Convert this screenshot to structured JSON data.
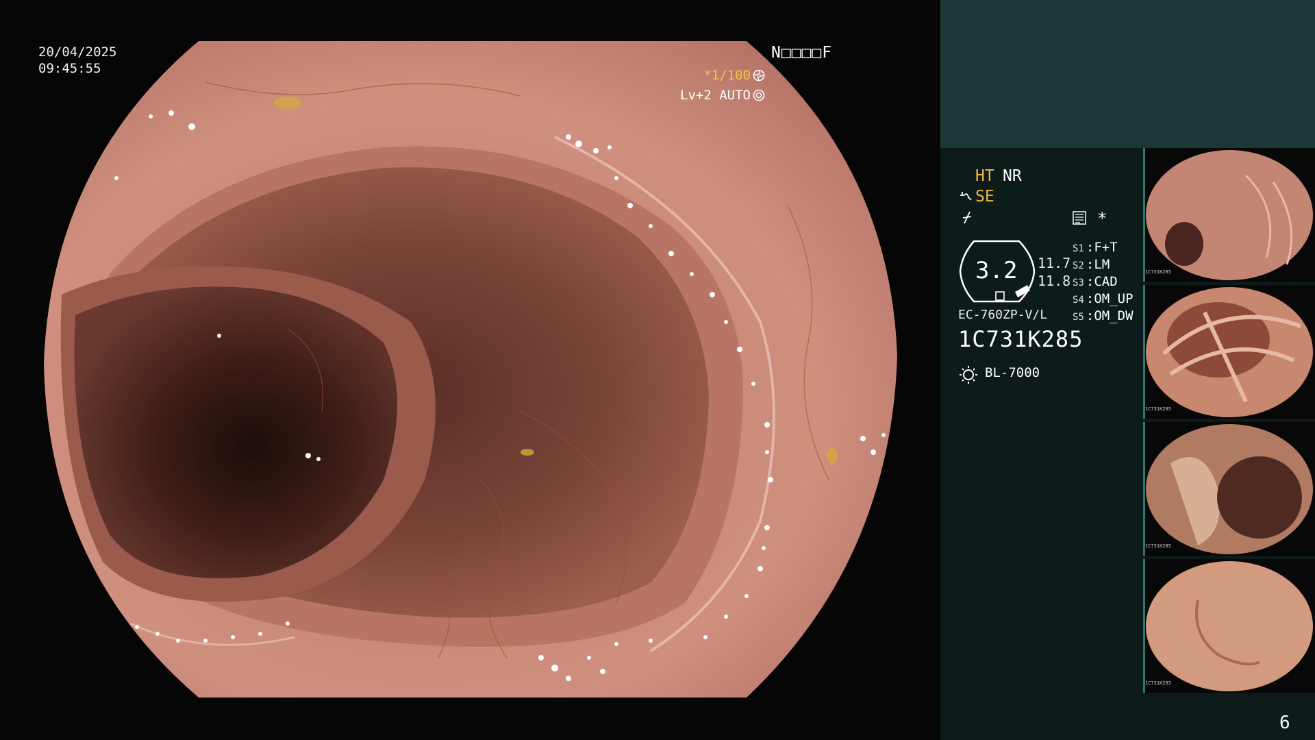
{
  "main_view": {
    "date": "20/04/2025",
    "time": "09:45:55",
    "mode_code": "N□□□□F",
    "shutter": "*1/100",
    "level": "Lv+2 AUTO"
  },
  "panel": {
    "ht": "HT",
    "nr": "NR",
    "se": "SE",
    "star": "*",
    "zoom": "3.2",
    "rates": [
      "11.7",
      "11.8"
    ],
    "switches": [
      {
        "key": "S1",
        "value": "F+T"
      },
      {
        "key": "S2",
        "value": "LM"
      },
      {
        "key": "S3",
        "value": "CAD"
      },
      {
        "key": "S4",
        "value": "OM_UP"
      },
      {
        "key": "S5",
        "value": "OM_DW"
      }
    ],
    "scope_model": "EC-760ZP-V/L",
    "scope_serial": "1C731K285",
    "light_source": "BL-7000",
    "page_number": "6"
  },
  "thumbnails": [
    {
      "serial": "1C731K285",
      "index": "1"
    },
    {
      "serial": "1C731K285",
      "index": "1"
    },
    {
      "serial": "1C731K285",
      "index": "1"
    },
    {
      "serial": "1C731K285",
      "index": "2"
    }
  ],
  "colors": {
    "mucosa": "#c98778",
    "lumen": "#2a1410",
    "panel_bg": "#0d1b1b",
    "panel_top": "#1b3836",
    "accent_orange": "#f2b83a"
  },
  "icons": [
    "shutter-icon",
    "auto-icon",
    "structure-enhance-icon",
    "color-enhance-icon",
    "document-icon",
    "light-source-icon"
  ]
}
